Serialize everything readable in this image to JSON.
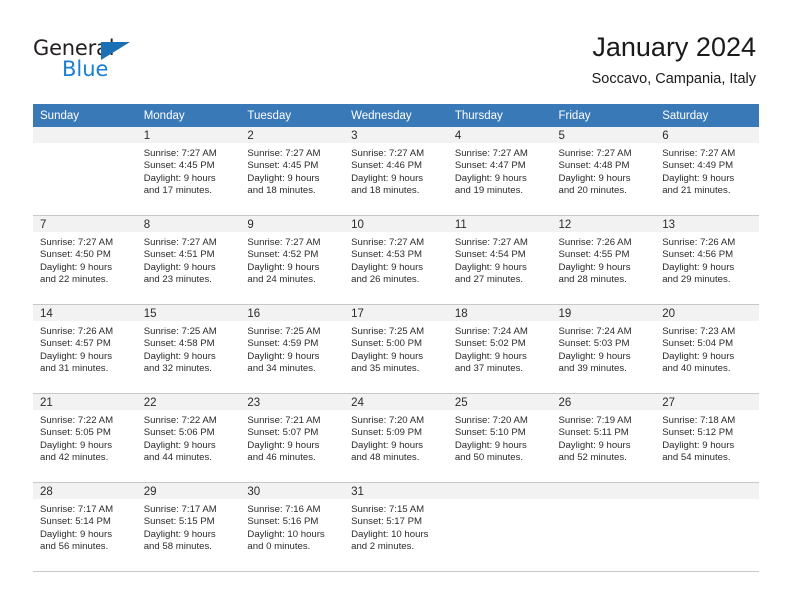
{
  "brand": {
    "name_part1": "General",
    "name_part2": "Blue",
    "accent_color": "#1a7fd4",
    "triangle_color": "#1a6fb5"
  },
  "header": {
    "title": "January 2024",
    "subtitle": "Soccavo, Campania, Italy"
  },
  "theme": {
    "header_row_bg": "#3a79b8",
    "daynum_bg": "#f2f2f2",
    "grid_line": "#c8c8c8"
  },
  "weekdays": [
    "Sunday",
    "Monday",
    "Tuesday",
    "Wednesday",
    "Thursday",
    "Friday",
    "Saturday"
  ],
  "weeks": [
    [
      {
        "day": "",
        "lines": []
      },
      {
        "day": "1",
        "lines": [
          "Sunrise: 7:27 AM",
          "Sunset: 4:45 PM",
          "Daylight: 9 hours",
          "and 17 minutes."
        ]
      },
      {
        "day": "2",
        "lines": [
          "Sunrise: 7:27 AM",
          "Sunset: 4:45 PM",
          "Daylight: 9 hours",
          "and 18 minutes."
        ]
      },
      {
        "day": "3",
        "lines": [
          "Sunrise: 7:27 AM",
          "Sunset: 4:46 PM",
          "Daylight: 9 hours",
          "and 18 minutes."
        ]
      },
      {
        "day": "4",
        "lines": [
          "Sunrise: 7:27 AM",
          "Sunset: 4:47 PM",
          "Daylight: 9 hours",
          "and 19 minutes."
        ]
      },
      {
        "day": "5",
        "lines": [
          "Sunrise: 7:27 AM",
          "Sunset: 4:48 PM",
          "Daylight: 9 hours",
          "and 20 minutes."
        ]
      },
      {
        "day": "6",
        "lines": [
          "Sunrise: 7:27 AM",
          "Sunset: 4:49 PM",
          "Daylight: 9 hours",
          "and 21 minutes."
        ]
      }
    ],
    [
      {
        "day": "7",
        "lines": [
          "Sunrise: 7:27 AM",
          "Sunset: 4:50 PM",
          "Daylight: 9 hours",
          "and 22 minutes."
        ]
      },
      {
        "day": "8",
        "lines": [
          "Sunrise: 7:27 AM",
          "Sunset: 4:51 PM",
          "Daylight: 9 hours",
          "and 23 minutes."
        ]
      },
      {
        "day": "9",
        "lines": [
          "Sunrise: 7:27 AM",
          "Sunset: 4:52 PM",
          "Daylight: 9 hours",
          "and 24 minutes."
        ]
      },
      {
        "day": "10",
        "lines": [
          "Sunrise: 7:27 AM",
          "Sunset: 4:53 PM",
          "Daylight: 9 hours",
          "and 26 minutes."
        ]
      },
      {
        "day": "11",
        "lines": [
          "Sunrise: 7:27 AM",
          "Sunset: 4:54 PM",
          "Daylight: 9 hours",
          "and 27 minutes."
        ]
      },
      {
        "day": "12",
        "lines": [
          "Sunrise: 7:26 AM",
          "Sunset: 4:55 PM",
          "Daylight: 9 hours",
          "and 28 minutes."
        ]
      },
      {
        "day": "13",
        "lines": [
          "Sunrise: 7:26 AM",
          "Sunset: 4:56 PM",
          "Daylight: 9 hours",
          "and 29 minutes."
        ]
      }
    ],
    [
      {
        "day": "14",
        "lines": [
          "Sunrise: 7:26 AM",
          "Sunset: 4:57 PM",
          "Daylight: 9 hours",
          "and 31 minutes."
        ]
      },
      {
        "day": "15",
        "lines": [
          "Sunrise: 7:25 AM",
          "Sunset: 4:58 PM",
          "Daylight: 9 hours",
          "and 32 minutes."
        ]
      },
      {
        "day": "16",
        "lines": [
          "Sunrise: 7:25 AM",
          "Sunset: 4:59 PM",
          "Daylight: 9 hours",
          "and 34 minutes."
        ]
      },
      {
        "day": "17",
        "lines": [
          "Sunrise: 7:25 AM",
          "Sunset: 5:00 PM",
          "Daylight: 9 hours",
          "and 35 minutes."
        ]
      },
      {
        "day": "18",
        "lines": [
          "Sunrise: 7:24 AM",
          "Sunset: 5:02 PM",
          "Daylight: 9 hours",
          "and 37 minutes."
        ]
      },
      {
        "day": "19",
        "lines": [
          "Sunrise: 7:24 AM",
          "Sunset: 5:03 PM",
          "Daylight: 9 hours",
          "and 39 minutes."
        ]
      },
      {
        "day": "20",
        "lines": [
          "Sunrise: 7:23 AM",
          "Sunset: 5:04 PM",
          "Daylight: 9 hours",
          "and 40 minutes."
        ]
      }
    ],
    [
      {
        "day": "21",
        "lines": [
          "Sunrise: 7:22 AM",
          "Sunset: 5:05 PM",
          "Daylight: 9 hours",
          "and 42 minutes."
        ]
      },
      {
        "day": "22",
        "lines": [
          "Sunrise: 7:22 AM",
          "Sunset: 5:06 PM",
          "Daylight: 9 hours",
          "and 44 minutes."
        ]
      },
      {
        "day": "23",
        "lines": [
          "Sunrise: 7:21 AM",
          "Sunset: 5:07 PM",
          "Daylight: 9 hours",
          "and 46 minutes."
        ]
      },
      {
        "day": "24",
        "lines": [
          "Sunrise: 7:20 AM",
          "Sunset: 5:09 PM",
          "Daylight: 9 hours",
          "and 48 minutes."
        ]
      },
      {
        "day": "25",
        "lines": [
          "Sunrise: 7:20 AM",
          "Sunset: 5:10 PM",
          "Daylight: 9 hours",
          "and 50 minutes."
        ]
      },
      {
        "day": "26",
        "lines": [
          "Sunrise: 7:19 AM",
          "Sunset: 5:11 PM",
          "Daylight: 9 hours",
          "and 52 minutes."
        ]
      },
      {
        "day": "27",
        "lines": [
          "Sunrise: 7:18 AM",
          "Sunset: 5:12 PM",
          "Daylight: 9 hours",
          "and 54 minutes."
        ]
      }
    ],
    [
      {
        "day": "28",
        "lines": [
          "Sunrise: 7:17 AM",
          "Sunset: 5:14 PM",
          "Daylight: 9 hours",
          "and 56 minutes."
        ]
      },
      {
        "day": "29",
        "lines": [
          "Sunrise: 7:17 AM",
          "Sunset: 5:15 PM",
          "Daylight: 9 hours",
          "and 58 minutes."
        ]
      },
      {
        "day": "30",
        "lines": [
          "Sunrise: 7:16 AM",
          "Sunset: 5:16 PM",
          "Daylight: 10 hours",
          "and 0 minutes."
        ]
      },
      {
        "day": "31",
        "lines": [
          "Sunrise: 7:15 AM",
          "Sunset: 5:17 PM",
          "Daylight: 10 hours",
          "and 2 minutes."
        ]
      },
      {
        "day": "",
        "lines": []
      },
      {
        "day": "",
        "lines": []
      },
      {
        "day": "",
        "lines": []
      }
    ]
  ]
}
